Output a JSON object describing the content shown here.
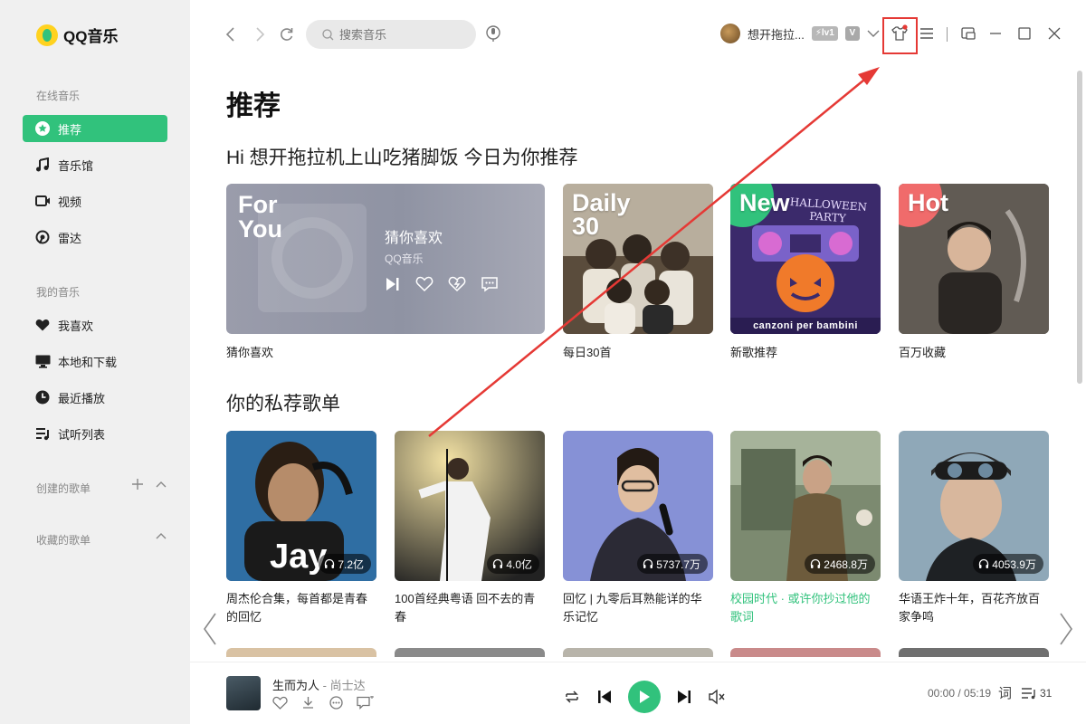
{
  "app": {
    "logo_text": "QQ音乐"
  },
  "sidebar": {
    "online_section": "在线音乐",
    "online_items": [
      {
        "label": "推荐",
        "icon": "star-icon",
        "active": true
      },
      {
        "label": "音乐馆",
        "icon": "music-note-icon"
      },
      {
        "label": "视频",
        "icon": "video-icon"
      },
      {
        "label": "雷达",
        "icon": "radar-icon"
      }
    ],
    "my_section": "我的音乐",
    "my_items": [
      {
        "label": "我喜欢",
        "icon": "heart-icon"
      },
      {
        "label": "本地和下载",
        "icon": "monitor-icon"
      },
      {
        "label": "最近播放",
        "icon": "clock-icon"
      },
      {
        "label": "试听列表",
        "icon": "playlist-icon"
      }
    ],
    "created_section": "创建的歌单",
    "collected_section": "收藏的歌单"
  },
  "topbar": {
    "search_placeholder": "搜索音乐",
    "username": "想开拖拉...",
    "level_badge": "lv1",
    "vip_badge": "V"
  },
  "main": {
    "title": "推荐",
    "greeting": "Hi 想开拖拉机上山吃猪脚饭 今日为你推荐",
    "for_you": {
      "tag_line1": "For",
      "tag_line2": "You",
      "name": "猜你喜欢",
      "source": "QQ音乐",
      "label": "猜你喜欢"
    },
    "featured": [
      {
        "tag_line1": "Daily",
        "tag_line2": "30",
        "label": "每日30首",
        "tag_color": "#31c27c"
      },
      {
        "tag_line1": "New",
        "tag_line2": "",
        "label": "新歌推荐",
        "tag_color": "#31c27c",
        "cover_text_top": "HALLOWEEN PARTY",
        "cover_text_bottom": "canzoni per bambini"
      },
      {
        "tag_line1": "Hot",
        "tag_line2": "",
        "label": "百万收藏",
        "tag_color": "#f06b6b"
      }
    ],
    "playlists_title": "你的私荐歌单",
    "playlists": [
      {
        "count": "7.2亿",
        "title": "周杰伦合集，每首都是青春的回忆",
        "highlight": false,
        "cover_text": "Jay"
      },
      {
        "count": "4.0亿",
        "title": "100首经典粤语 回不去的青春",
        "highlight": false
      },
      {
        "count": "5737.7万",
        "title": "回忆 | 九零后耳熟能详的华乐记忆",
        "highlight": false
      },
      {
        "count": "2468.8万",
        "title": "校园时代 · 或许你抄过他的歌词",
        "highlight": true
      },
      {
        "count": "4053.9万",
        "title": "华语王炸十年，百花齐放百家争鸣",
        "highlight": false
      }
    ]
  },
  "player": {
    "song": "生而为人",
    "artist": "尚士达",
    "separator": " - ",
    "time": "00:00 / 05:19",
    "lyric_label": "词",
    "queue_count": "31"
  },
  "colors": {
    "accent": "#31c27c",
    "highlight_box": "#e53935",
    "arrow": "#e53935"
  }
}
